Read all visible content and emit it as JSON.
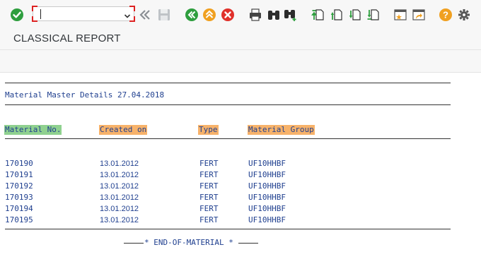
{
  "toolbar": {
    "command_field_value": "",
    "icons": [
      "enter-check-icon",
      "back-double-chevron-icon",
      "save-icon",
      "back-icon",
      "exit-up-icon",
      "cancel-icon",
      "print-icon",
      "find-binoculars-icon",
      "find-next-binoculars-icon",
      "first-page-icon",
      "previous-page-icon",
      "next-page-icon",
      "last-page-icon",
      "create-session-icon",
      "create-shortcut-icon",
      "help-icon",
      "customize-settings-icon"
    ]
  },
  "title": "CLASSICAL REPORT",
  "report": {
    "heading": "Material Master Details 27.04.2018",
    "columns": [
      {
        "label": "Material No.",
        "color": "#8fd18f"
      },
      {
        "label": "Created on",
        "color": "#f7b26a"
      },
      {
        "label": "Type",
        "color": "#f7b26a"
      },
      {
        "label": "Material Group",
        "color": "#f7b26a"
      }
    ],
    "rows": [
      {
        "material_no": "170190",
        "created_on": "13.01.2012",
        "type": "FERT",
        "group": "UF10HHBF"
      },
      {
        "material_no": "170191",
        "created_on": "13.01.2012",
        "type": "FERT",
        "group": "UF10HHBF"
      },
      {
        "material_no": "170192",
        "created_on": "13.01.2012",
        "type": "FERT",
        "group": "UF10HHBF"
      },
      {
        "material_no": "170193",
        "created_on": "13.01.2012",
        "type": "FERT",
        "group": "UF10HHBF"
      },
      {
        "material_no": "170194",
        "created_on": "13.01.2012",
        "type": "FERT",
        "group": "UF10HHBF"
      },
      {
        "material_no": "170195",
        "created_on": "13.01.2012",
        "type": "FERT",
        "group": "UF10HHBF"
      }
    ],
    "footer": "* END-OF-MATERIAL *"
  },
  "colors": {
    "text": "#1f3f8f",
    "accent_green": "#2e9e3e",
    "accent_orange": "#f0a020",
    "accent_red": "#e0302a"
  }
}
